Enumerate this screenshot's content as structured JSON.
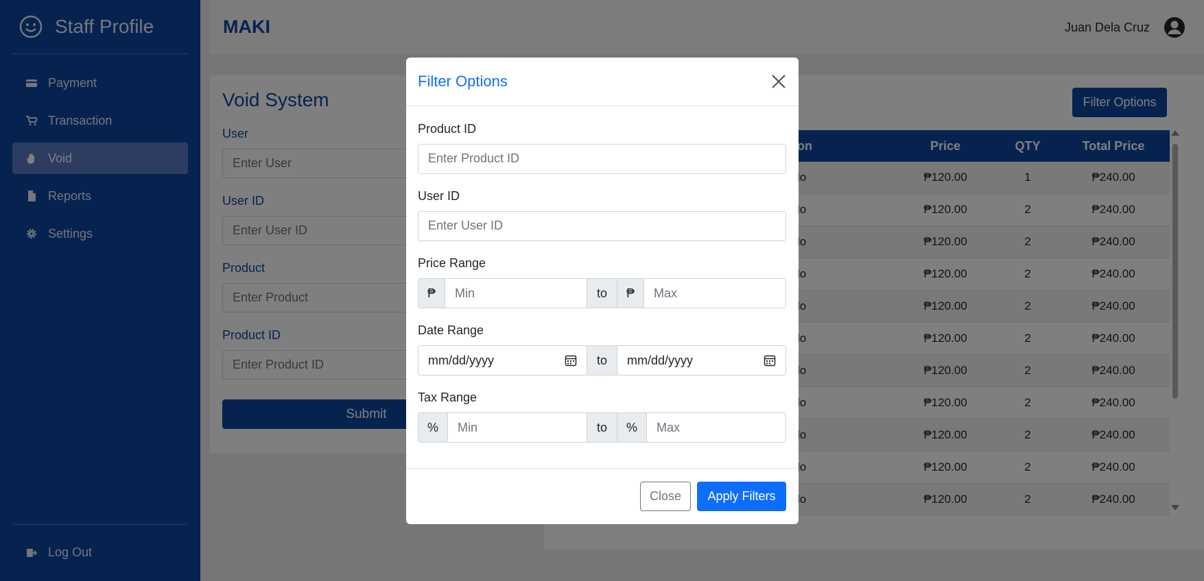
{
  "sidebar": {
    "title": "Staff Profile",
    "items": [
      {
        "label": "Payment",
        "icon": "credit-card-icon"
      },
      {
        "label": "Transaction",
        "icon": "cart-icon"
      },
      {
        "label": "Void",
        "icon": "hand-icon"
      },
      {
        "label": "Reports",
        "icon": "file-icon"
      },
      {
        "label": "Settings",
        "icon": "gear-icon"
      }
    ],
    "active": "Void",
    "logout": "Log Out"
  },
  "header": {
    "logo": "MAKI",
    "user_name": "Juan Dela Cruz"
  },
  "void_form": {
    "title": "Void System",
    "fields": [
      {
        "label": "User",
        "placeholder": "Enter User"
      },
      {
        "label": "User ID",
        "placeholder": "Enter User ID"
      },
      {
        "label": "Product",
        "placeholder": "Enter Product"
      },
      {
        "label": "Product ID",
        "placeholder": "Enter Product ID"
      }
    ],
    "submit": "Submit"
  },
  "table": {
    "filter_button": "Filter Options",
    "columns": [
      "on",
      "Price",
      "QTY",
      "Total Price"
    ],
    "rows": [
      {
        "name": "lo",
        "price": "₱120.00",
        "qty": "1",
        "total": "₱240.00"
      },
      {
        "name": "lo",
        "price": "₱120.00",
        "qty": "2",
        "total": "₱240.00"
      },
      {
        "name": "lo",
        "price": "₱120.00",
        "qty": "2",
        "total": "₱240.00"
      },
      {
        "name": "lo",
        "price": "₱120.00",
        "qty": "2",
        "total": "₱240.00"
      },
      {
        "name": "lo",
        "price": "₱120.00",
        "qty": "2",
        "total": "₱240.00"
      },
      {
        "name": "lo",
        "price": "₱120.00",
        "qty": "2",
        "total": "₱240.00"
      },
      {
        "name": "lo",
        "price": "₱120.00",
        "qty": "2",
        "total": "₱240.00"
      },
      {
        "name": "lo",
        "price": "₱120.00",
        "qty": "2",
        "total": "₱240.00"
      },
      {
        "name": "lo",
        "price": "₱120.00",
        "qty": "2",
        "total": "₱240.00"
      },
      {
        "name": "lo",
        "price": "₱120.00",
        "qty": "2",
        "total": "₱240.00"
      },
      {
        "name": "lo",
        "price": "₱120.00",
        "qty": "2",
        "total": "₱240.00"
      }
    ]
  },
  "modal": {
    "title": "Filter Options",
    "product_id": {
      "label": "Product ID",
      "placeholder": "Enter Product ID"
    },
    "user_id": {
      "label": "User ID",
      "placeholder": "Enter User ID"
    },
    "price_range": {
      "label": "Price Range",
      "currency": "₱",
      "min": "Min",
      "to": "to",
      "max": "Max"
    },
    "date_range": {
      "label": "Date Range",
      "start": "mm/dd/yyyy",
      "to": "to",
      "end": "mm/dd/yyyy"
    },
    "tax_range": {
      "label": "Tax Range",
      "unit": "%",
      "min": "Min",
      "to": "to",
      "max": "Max"
    },
    "close": "Close",
    "apply": "Apply Filters"
  },
  "colors": {
    "primary": "#0d47a1",
    "accent": "#0d6efd",
    "active_nav": "#5b79c2"
  }
}
